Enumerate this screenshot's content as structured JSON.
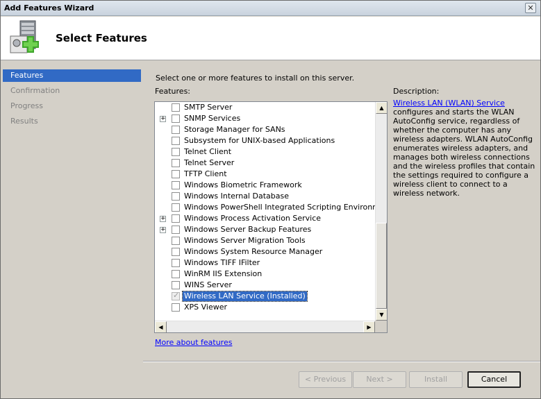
{
  "window": {
    "title": "Add Features Wizard",
    "close_glyph": "✕"
  },
  "header": {
    "title": "Select Features",
    "icon": "server-add-icon"
  },
  "nav": {
    "items": [
      {
        "label": "Features",
        "active": true
      },
      {
        "label": "Confirmation",
        "active": false
      },
      {
        "label": "Progress",
        "active": false
      },
      {
        "label": "Results",
        "active": false
      }
    ]
  },
  "main": {
    "instruction": "Select one or more features to install on this server.",
    "features_label": "Features:",
    "features": [
      {
        "label": "SMTP Server",
        "expandable": false,
        "checked": false,
        "disabled": false,
        "selected": false
      },
      {
        "label": "SNMP Services",
        "expandable": true,
        "checked": false,
        "disabled": false,
        "selected": false
      },
      {
        "label": "Storage Manager for SANs",
        "expandable": false,
        "checked": false,
        "disabled": false,
        "selected": false
      },
      {
        "label": "Subsystem for UNIX-based Applications",
        "expandable": false,
        "checked": false,
        "disabled": false,
        "selected": false
      },
      {
        "label": "Telnet Client",
        "expandable": false,
        "checked": false,
        "disabled": false,
        "selected": false
      },
      {
        "label": "Telnet Server",
        "expandable": false,
        "checked": false,
        "disabled": false,
        "selected": false
      },
      {
        "label": "TFTP Client",
        "expandable": false,
        "checked": false,
        "disabled": false,
        "selected": false
      },
      {
        "label": "Windows Biometric Framework",
        "expandable": false,
        "checked": false,
        "disabled": false,
        "selected": false
      },
      {
        "label": "Windows Internal Database",
        "expandable": false,
        "checked": false,
        "disabled": false,
        "selected": false
      },
      {
        "label": "Windows PowerShell Integrated Scripting Environment (IS",
        "expandable": false,
        "checked": false,
        "disabled": false,
        "selected": false
      },
      {
        "label": "Windows Process Activation Service",
        "expandable": true,
        "checked": false,
        "disabled": false,
        "selected": false
      },
      {
        "label": "Windows Server Backup Features",
        "expandable": true,
        "checked": false,
        "disabled": false,
        "selected": false
      },
      {
        "label": "Windows Server Migration Tools",
        "expandable": false,
        "checked": false,
        "disabled": false,
        "selected": false
      },
      {
        "label": "Windows System Resource Manager",
        "expandable": false,
        "checked": false,
        "disabled": false,
        "selected": false
      },
      {
        "label": "Windows TIFF IFilter",
        "expandable": false,
        "checked": false,
        "disabled": false,
        "selected": false
      },
      {
        "label": "WinRM IIS Extension",
        "expandable": false,
        "checked": false,
        "disabled": false,
        "selected": false
      },
      {
        "label": "WINS Server",
        "expandable": false,
        "checked": false,
        "disabled": false,
        "selected": false
      },
      {
        "label": "Wireless LAN Service  (Installed)",
        "expandable": false,
        "checked": true,
        "disabled": true,
        "selected": true
      },
      {
        "label": "XPS Viewer",
        "expandable": false,
        "checked": false,
        "disabled": false,
        "selected": false
      }
    ],
    "expander_glyph": "+",
    "scroll_up_glyph": "▲",
    "scroll_down_glyph": "▼",
    "scroll_left_glyph": "◀",
    "scroll_right_glyph": "▶",
    "description": {
      "label": "Description:",
      "link_text": "Wireless LAN (WLAN) Service",
      "body": " configures and starts the WLAN AutoConfig service, regardless of whether the computer has any wireless adapters. WLAN AutoConfig enumerates wireless adapters, and manages both wireless connections and the wireless profiles that contain the settings required to configure a wireless client to connect to a wireless network."
    },
    "more_link": "More about features"
  },
  "footer": {
    "previous": "< Previous",
    "next": "Next >",
    "install": "Install",
    "cancel": "Cancel"
  },
  "colors": {
    "selection": "#316ac5",
    "link": "#0000ff",
    "window_bg": "#d4d0c8"
  }
}
